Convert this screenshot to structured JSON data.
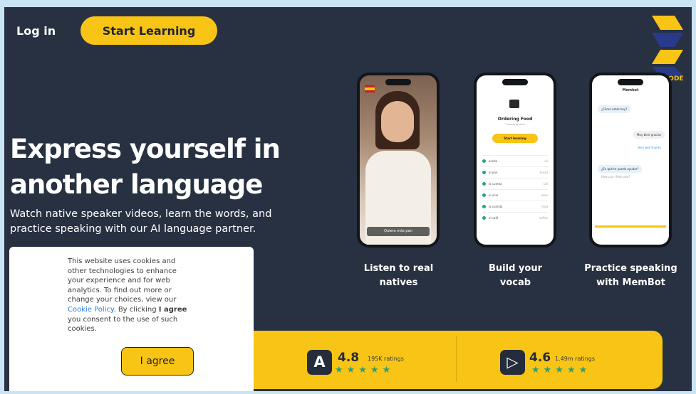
{
  "header": {
    "login": "Log in",
    "start_learning": "Start Learning"
  },
  "logo": {
    "text": "IRACODE",
    "colors": {
      "primary": "#f8c415",
      "secondary": "#2a3a8a"
    }
  },
  "hero": {
    "title_line1": "Express yourself in",
    "title_line2": "another language",
    "subtitle": "Watch native speaker videos, learn the words, and practice speaking with our AI language partner."
  },
  "phones": {
    "video": {
      "caption": "Quiero más pan"
    },
    "vocab": {
      "title": "Ordering Food",
      "subtitle": "7 words to learn",
      "button": "Start learning",
      "rows": [
        {
          "word": "aceite",
          "translation": "oil"
        },
        {
          "word": "el pan",
          "translation": "bread"
        },
        {
          "word": "la cuenta",
          "translation": "bill"
        },
        {
          "word": "el vino",
          "translation": "wine"
        },
        {
          "word": "la comida",
          "translation": "food"
        },
        {
          "word": "el café",
          "translation": "coffee"
        }
      ]
    },
    "chat": {
      "title": "Membot",
      "msg1": "¿Cómo estás hoy?",
      "msg2": "Muy bien gracias",
      "msg3": "Very well thanks",
      "msg4": "¿En qué te puedo ayudar?",
      "msg5": "How can I help you?"
    }
  },
  "features": [
    {
      "line1": "Listen to real",
      "line2": "natives"
    },
    {
      "line1": "Build your",
      "line2": "vocab"
    },
    {
      "line1": "Practice speaking",
      "line2": "with MemBot"
    }
  ],
  "ratings": {
    "app_store": {
      "icon": "app-store-icon",
      "score": "4.8",
      "count": "195K ratings",
      "stars": "★★★★★"
    },
    "play_store": {
      "icon": "play-store-icon",
      "score": "4.6",
      "count": "1.49m ratings",
      "stars": "★★★★★"
    }
  },
  "cookie": {
    "text_before": "This website uses cookies and other technologies to enhance your experience and for web analytics. To find out more or change your choices, view our",
    "link": "Cookie Policy",
    "text_mid": ". By clicking",
    "bold": "I agree",
    "text_after": "you consent to the use of such cookies.",
    "button": "I agree"
  },
  "colors": {
    "background": "#283142",
    "accent": "#f8c415",
    "star": "#2a9f79",
    "page": "#c9e4f5"
  }
}
